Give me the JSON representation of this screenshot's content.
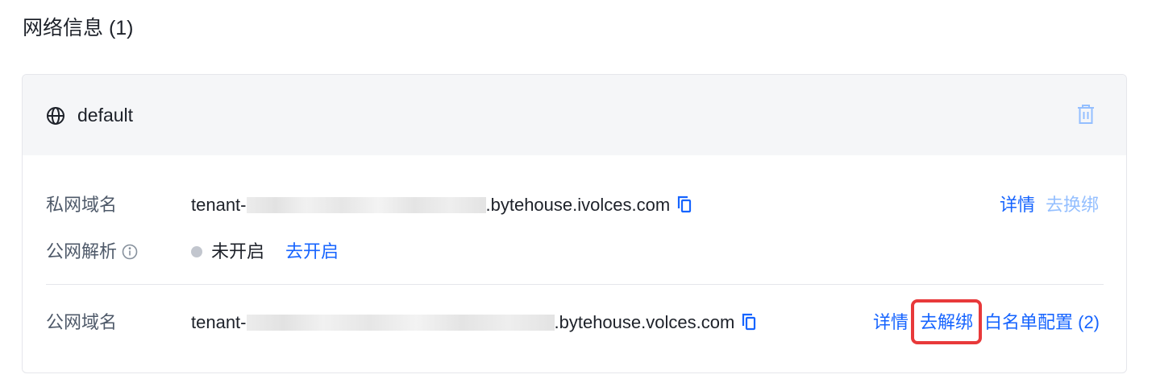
{
  "section": {
    "title": "网络信息 (1)"
  },
  "network": {
    "name": "default",
    "globe_icon": "globe-icon",
    "delete_icon": "trash-icon"
  },
  "private_domain": {
    "label": "私网域名",
    "prefix": "tenant-",
    "suffix": ".bytehouse.ivolces.com",
    "copy_icon": "copy-icon",
    "details_label": "详情",
    "rebind_label": "去换绑"
  },
  "public_resolution": {
    "label": "公网解析",
    "info_icon": "info-icon",
    "status": "未开启",
    "enable_label": "去开启"
  },
  "public_domain": {
    "label": "公网域名",
    "prefix": "tenant-",
    "suffix": ".bytehouse.volces.com",
    "copy_icon": "copy-icon",
    "details_label": "详情",
    "unbind_label": "去解绑",
    "whitelist_label": "白名单配置 (2)"
  },
  "colors": {
    "link": "#1664ff",
    "link_disabled": "#94bfff",
    "highlight": "#e8393a",
    "status_dot": "#c2c6ce"
  }
}
